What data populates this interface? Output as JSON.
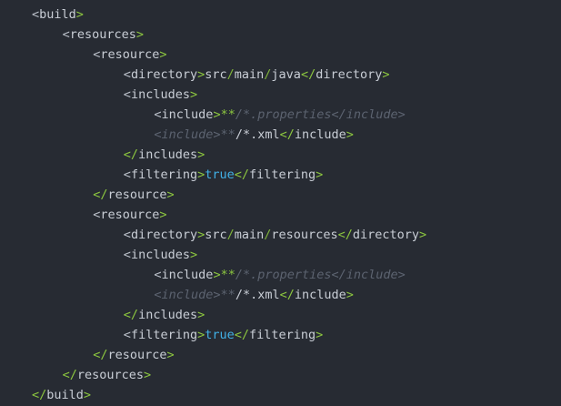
{
  "editor": {
    "colors": {
      "background": "#272b33",
      "tag_name": "#c9ced6",
      "close_bracket": "#8cc63f",
      "boolean": "#41b0e6",
      "comment": "#5c6370"
    },
    "lines": [
      {
        "indent": 0,
        "tokens": [
          {
            "t": "bracket",
            "v": "<"
          },
          {
            "t": "tag",
            "v": "build"
          },
          {
            "t": "close-bracket",
            "v": ">"
          }
        ]
      },
      {
        "indent": 1,
        "tokens": [
          {
            "t": "bracket",
            "v": "<"
          },
          {
            "t": "tag",
            "v": "resources"
          },
          {
            "t": "close-bracket",
            "v": ">"
          }
        ]
      },
      {
        "indent": 2,
        "tokens": [
          {
            "t": "bracket",
            "v": "<"
          },
          {
            "t": "tag",
            "v": "resource"
          },
          {
            "t": "close-bracket",
            "v": ">"
          }
        ]
      },
      {
        "indent": 3,
        "tokens": [
          {
            "t": "bracket",
            "v": "<"
          },
          {
            "t": "tag",
            "v": "directory"
          },
          {
            "t": "close-bracket",
            "v": ">"
          },
          {
            "t": "text",
            "v": "src"
          },
          {
            "t": "path-sep",
            "v": "/"
          },
          {
            "t": "text",
            "v": "main"
          },
          {
            "t": "path-sep",
            "v": "/"
          },
          {
            "t": "text",
            "v": "java"
          },
          {
            "t": "close-bracket",
            "v": "</"
          },
          {
            "t": "tag",
            "v": "directory"
          },
          {
            "t": "close-bracket",
            "v": ">"
          }
        ]
      },
      {
        "indent": 3,
        "tokens": [
          {
            "t": "bracket",
            "v": "<"
          },
          {
            "t": "tag",
            "v": "includes"
          },
          {
            "t": "close-bracket",
            "v": ">"
          }
        ]
      },
      {
        "indent": 4,
        "tokens": [
          {
            "t": "bracket",
            "v": "<"
          },
          {
            "t": "tag",
            "v": "include"
          },
          {
            "t": "close-bracket",
            "v": ">"
          },
          {
            "t": "glob",
            "v": "**"
          },
          {
            "t": "comment",
            "v": "/*.properties</include>"
          }
        ]
      },
      {
        "indent": 4,
        "tokens": [
          {
            "t": "comment",
            "v": "<include>"
          },
          {
            "t": "comment",
            "v": "**"
          },
          {
            "t": "text",
            "v": "/*.xml"
          },
          {
            "t": "close-bracket",
            "v": "</"
          },
          {
            "t": "tag",
            "v": "include"
          },
          {
            "t": "close-bracket",
            "v": ">"
          }
        ]
      },
      {
        "indent": 3,
        "tokens": [
          {
            "t": "close-bracket",
            "v": "</"
          },
          {
            "t": "tag",
            "v": "includes"
          },
          {
            "t": "close-bracket",
            "v": ">"
          }
        ]
      },
      {
        "indent": 3,
        "tokens": [
          {
            "t": "bracket",
            "v": "<"
          },
          {
            "t": "tag",
            "v": "filtering"
          },
          {
            "t": "close-bracket",
            "v": ">"
          },
          {
            "t": "bool",
            "v": "true"
          },
          {
            "t": "close-bracket",
            "v": "</"
          },
          {
            "t": "tag",
            "v": "filtering"
          },
          {
            "t": "close-bracket",
            "v": ">"
          }
        ]
      },
      {
        "indent": 2,
        "tokens": [
          {
            "t": "close-bracket",
            "v": "</"
          },
          {
            "t": "tag",
            "v": "resource"
          },
          {
            "t": "close-bracket",
            "v": ">"
          }
        ]
      },
      {
        "indent": 2,
        "tokens": [
          {
            "t": "bracket",
            "v": "<"
          },
          {
            "t": "tag",
            "v": "resource"
          },
          {
            "t": "close-bracket",
            "v": ">"
          }
        ]
      },
      {
        "indent": 3,
        "tokens": [
          {
            "t": "bracket",
            "v": "<"
          },
          {
            "t": "tag",
            "v": "directory"
          },
          {
            "t": "close-bracket",
            "v": ">"
          },
          {
            "t": "text",
            "v": "src"
          },
          {
            "t": "path-sep",
            "v": "/"
          },
          {
            "t": "text",
            "v": "main"
          },
          {
            "t": "path-sep",
            "v": "/"
          },
          {
            "t": "text",
            "v": "resources"
          },
          {
            "t": "close-bracket",
            "v": "</"
          },
          {
            "t": "tag",
            "v": "directory"
          },
          {
            "t": "close-bracket",
            "v": ">"
          }
        ]
      },
      {
        "indent": 3,
        "tokens": [
          {
            "t": "bracket",
            "v": "<"
          },
          {
            "t": "tag",
            "v": "includes"
          },
          {
            "t": "close-bracket",
            "v": ">"
          }
        ]
      },
      {
        "indent": 4,
        "tokens": [
          {
            "t": "bracket",
            "v": "<"
          },
          {
            "t": "tag",
            "v": "include"
          },
          {
            "t": "close-bracket",
            "v": ">"
          },
          {
            "t": "glob",
            "v": "**"
          },
          {
            "t": "comment",
            "v": "/*.properties</include>"
          }
        ]
      },
      {
        "indent": 4,
        "tokens": [
          {
            "t": "comment",
            "v": "<include>"
          },
          {
            "t": "comment",
            "v": "**"
          },
          {
            "t": "text",
            "v": "/*.xml"
          },
          {
            "t": "close-bracket",
            "v": "</"
          },
          {
            "t": "tag",
            "v": "include"
          },
          {
            "t": "close-bracket",
            "v": ">"
          }
        ]
      },
      {
        "indent": 3,
        "tokens": [
          {
            "t": "close-bracket",
            "v": "</"
          },
          {
            "t": "tag",
            "v": "includes"
          },
          {
            "t": "close-bracket",
            "v": ">"
          }
        ]
      },
      {
        "indent": 3,
        "tokens": [
          {
            "t": "bracket",
            "v": "<"
          },
          {
            "t": "tag",
            "v": "filtering"
          },
          {
            "t": "close-bracket",
            "v": ">"
          },
          {
            "t": "bool",
            "v": "true"
          },
          {
            "t": "close-bracket",
            "v": "</"
          },
          {
            "t": "tag",
            "v": "filtering"
          },
          {
            "t": "close-bracket",
            "v": ">"
          }
        ]
      },
      {
        "indent": 2,
        "tokens": [
          {
            "t": "close-bracket",
            "v": "</"
          },
          {
            "t": "tag",
            "v": "resource"
          },
          {
            "t": "close-bracket",
            "v": ">"
          }
        ]
      },
      {
        "indent": 1,
        "tokens": [
          {
            "t": "close-bracket",
            "v": "</"
          },
          {
            "t": "tag",
            "v": "resources"
          },
          {
            "t": "close-bracket",
            "v": ">"
          }
        ]
      },
      {
        "indent": 0,
        "tokens": [
          {
            "t": "close-bracket",
            "v": "</"
          },
          {
            "t": "tag",
            "v": "build"
          },
          {
            "t": "close-bracket",
            "v": ">"
          }
        ]
      }
    ]
  }
}
